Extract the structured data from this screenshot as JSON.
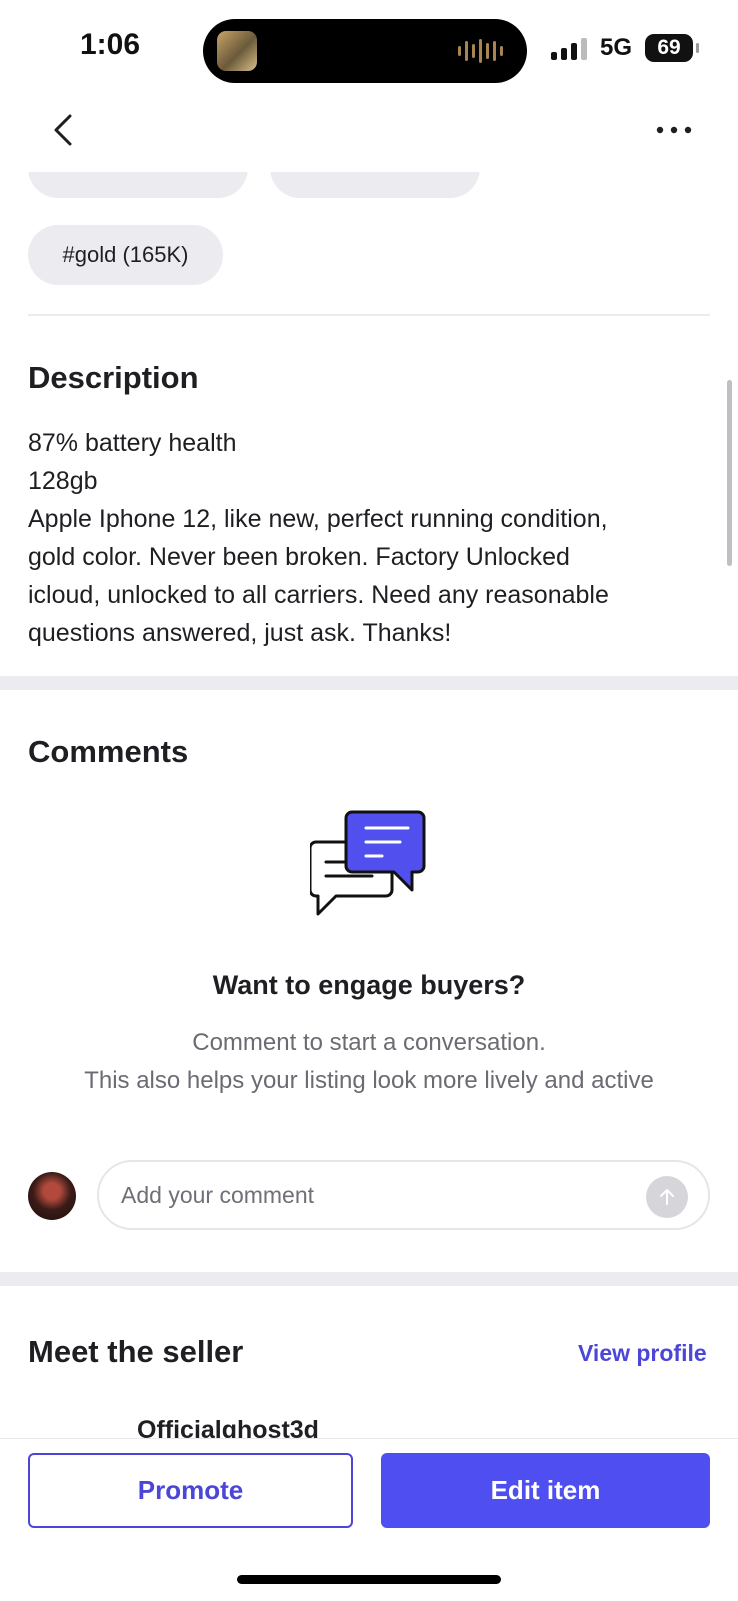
{
  "status_bar": {
    "time": "1:06",
    "network": "5G",
    "battery": "69"
  },
  "tags": {
    "gold": "#gold (165K)"
  },
  "description": {
    "title": "Description",
    "lines": [
      "87% battery health",
      "128gb",
      "Apple Iphone 12, like new, perfect running condition,",
      "gold color.  Never been broken.  Factory Unlocked",
      "icloud, unlocked to all carriers. Need any reasonable",
      "questions answered, just ask. Thanks!"
    ]
  },
  "comments": {
    "title": "Comments",
    "empty_title": "Want to engage buyers?",
    "empty_line1": "Comment to start a conversation.",
    "empty_line2": "This also helps your listing look more lively and active",
    "input_placeholder": "Add your comment"
  },
  "seller": {
    "title": "Meet the seller",
    "view_profile": "View profile",
    "name": "Officialghost3d"
  },
  "actions": {
    "promote": "Promote",
    "edit": "Edit item"
  },
  "colors": {
    "accent": "#4f4ef0",
    "link": "#4b46d8",
    "tag_bg": "#ececf0"
  },
  "icons": [
    "chevron-left-icon",
    "more-horizontal-icon",
    "chat-bubbles-icon",
    "arrow-up-icon"
  ]
}
